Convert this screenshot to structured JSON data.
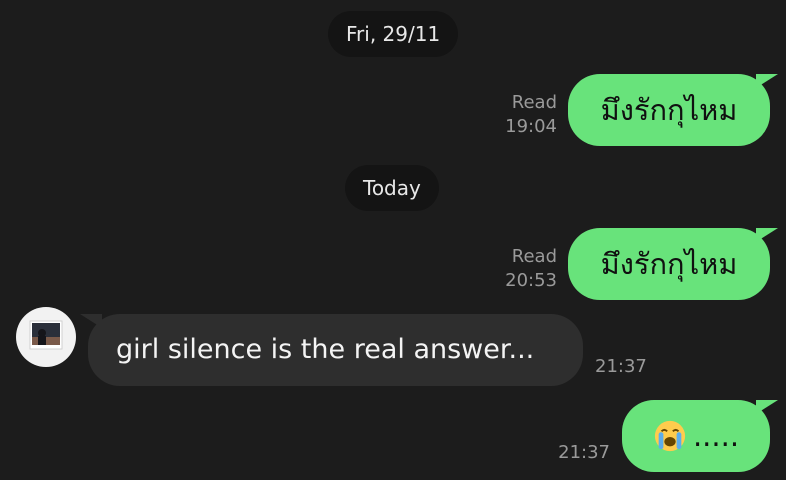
{
  "dates": {
    "first": "Fri, 29/11",
    "second": "Today"
  },
  "messages": [
    {
      "id": "m1",
      "direction": "outgoing",
      "text": "มึงรักกุไหม",
      "status": "Read",
      "time": "19:04"
    },
    {
      "id": "m2",
      "direction": "outgoing",
      "text": "มึงรักกุไหม",
      "status": "Read",
      "time": "20:53"
    },
    {
      "id": "m3",
      "direction": "incoming",
      "text": "girl silence is the real answer...",
      "time": "21:37"
    },
    {
      "id": "m4",
      "direction": "outgoing",
      "emoji": "loudly-crying-face-emoji",
      "text": ".....",
      "time": "21:37"
    }
  ],
  "colors": {
    "background": "#1c1c1c",
    "outgoing_bubble": "#68e37b",
    "incoming_bubble": "#2e2e2e",
    "date_pill": "#141414",
    "meta_text": "#9a9a9a"
  }
}
